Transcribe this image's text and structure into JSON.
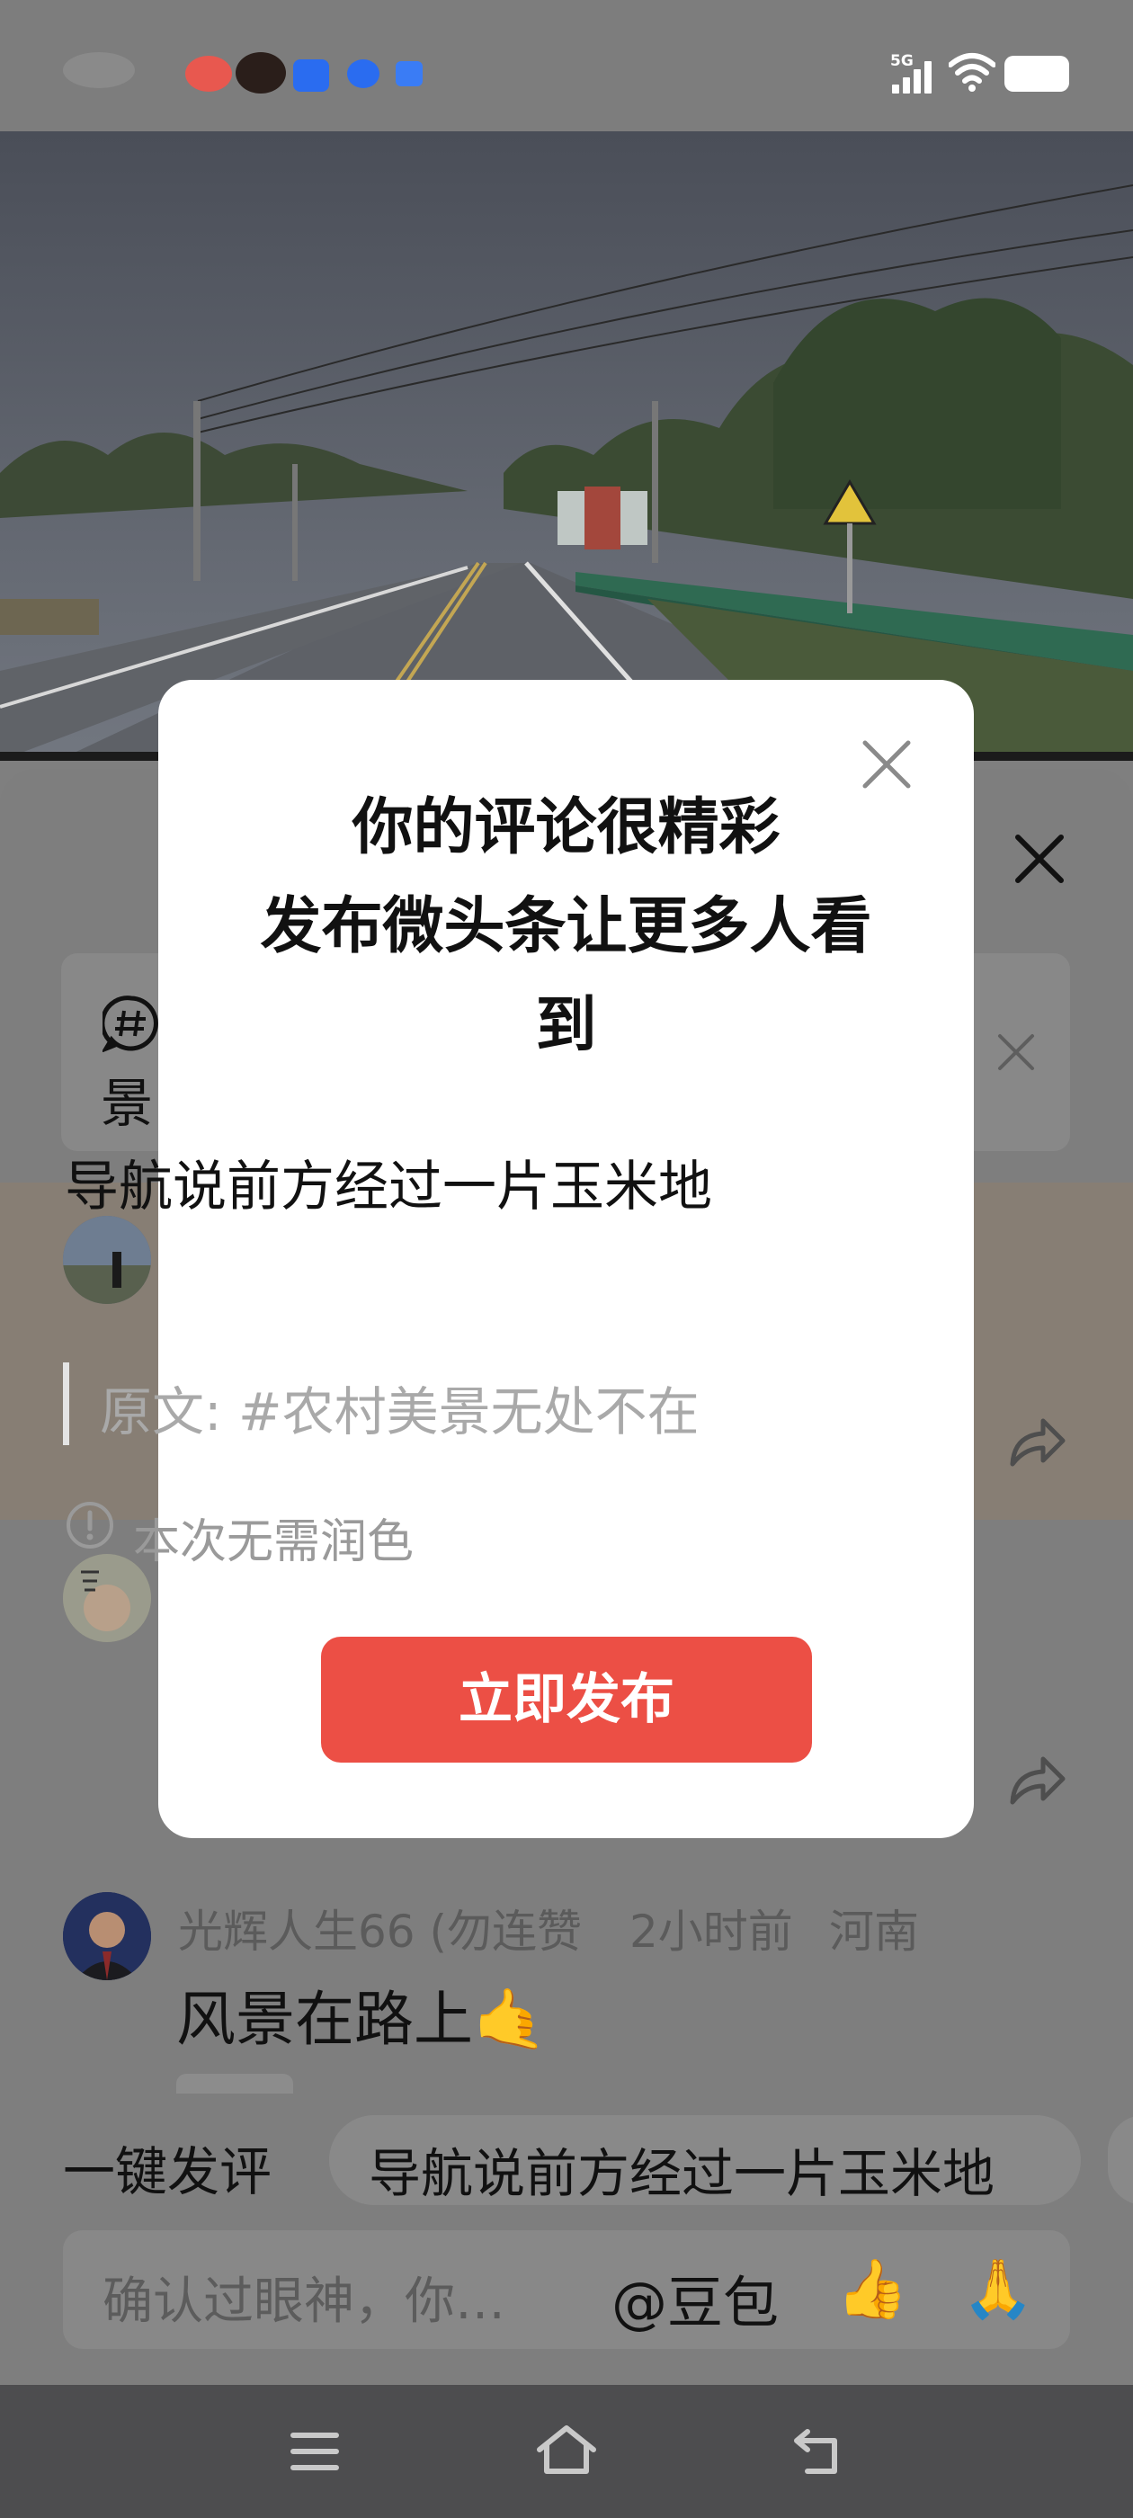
{
  "modal": {
    "title_line1": "你的评论很精彩",
    "title_line2": "发布微头条让更多人看",
    "title_line3": "到",
    "comment_text": "导航说前方经过一片玉米地",
    "original_quote": "原文: #农村美景无处不在",
    "notice": "本次无需润色",
    "publish_label": "立即发布",
    "close_icon": "close-icon"
  },
  "sheet": {
    "topic_char": "景",
    "comment_user": "光辉人生66 (勿连赞",
    "comment_time": "2小时前",
    "comment_location": "河南",
    "comment_text": "风景在路上",
    "comment_emoji": "🤙"
  },
  "bottom": {
    "quick_label": "一键发评",
    "quick_suggestion": "导航说前方经过一片玉米地",
    "input_placeholder": "确认过眼神，你…",
    "mention": "@豆包",
    "emoji1": "👍",
    "emoji2": "🙏"
  },
  "colors": {
    "accent": "#ec4f45",
    "overlay": "#7f7f7f"
  }
}
